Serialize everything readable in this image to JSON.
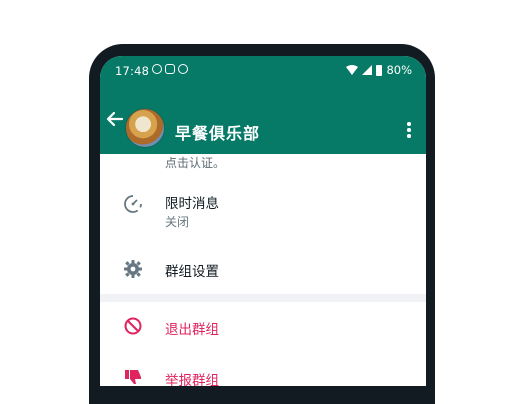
{
  "statusbar": {
    "time": "17:48",
    "battery": "80%"
  },
  "appbar": {
    "title": "早餐俱乐部"
  },
  "content": {
    "top_hint": "点击认证。",
    "disappearing": {
      "title": "限时消息",
      "subtitle": "关闭"
    },
    "group_settings": {
      "title": "群组设置"
    },
    "exit_group": {
      "title": "退出群组"
    },
    "report_group": {
      "title": "举报群组"
    }
  },
  "colors": {
    "brand": "#067a66",
    "danger": "#e0245e",
    "phone_frame": "#121b22"
  }
}
